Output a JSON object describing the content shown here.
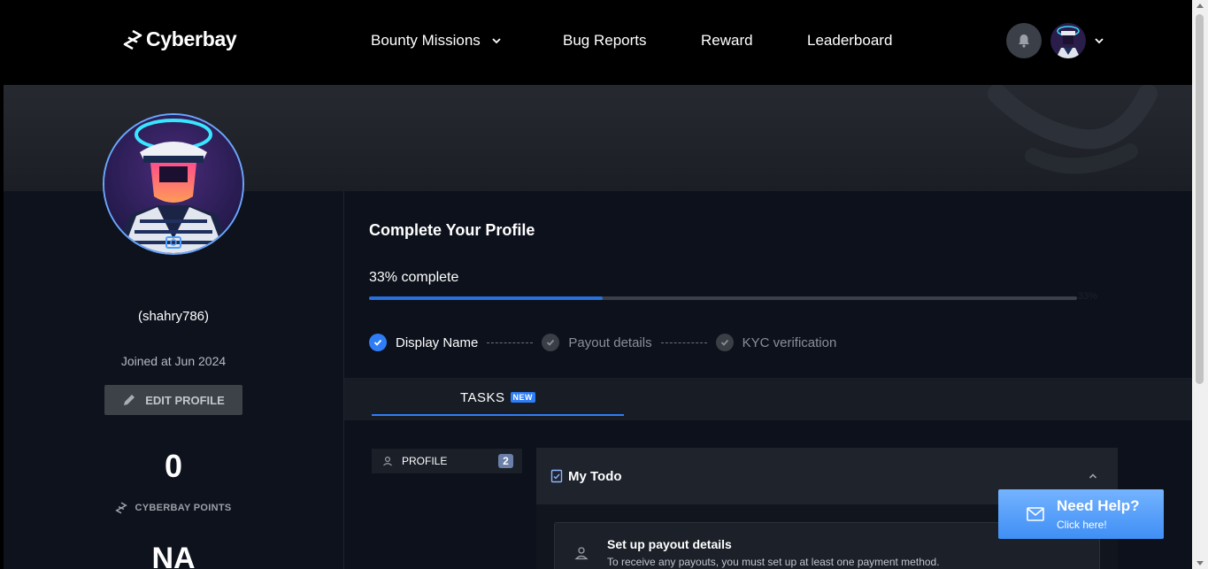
{
  "brand": {
    "name": "Cyberbay"
  },
  "nav": {
    "items": [
      {
        "label": "Bounty Missions",
        "has_dropdown": true
      },
      {
        "label": "Bug Reports"
      },
      {
        "label": "Reward"
      },
      {
        "label": "Leaderboard"
      }
    ]
  },
  "profile": {
    "username": "(shahry786)",
    "joined": "Joined at Jun 2024",
    "edit_label": "EDIT PROFILE",
    "points_value": "0",
    "points_label": "CYBERBAY POINTS",
    "rank_value": "NA"
  },
  "completion": {
    "title": "Complete Your Profile",
    "progress_text": "33% complete",
    "progress_percent": 33,
    "progress_end_label": "33%",
    "steps": [
      {
        "label": "Display Name",
        "done": true
      },
      {
        "label": "Payout details",
        "done": false
      },
      {
        "label": "KYC verification",
        "done": false
      }
    ]
  },
  "tasks": {
    "tab_label": "TASKS",
    "new_badge": "NEW",
    "category_label": "PROFILE",
    "category_count": "2",
    "todo_title": "My Todo",
    "items": [
      {
        "title": "Set up payout details",
        "description": "To receive any payouts, you must set up at least one payment method."
      }
    ]
  },
  "help": {
    "title": "Need Help?",
    "subtitle": "Click here!"
  },
  "colors": {
    "accent": "#2f7df6",
    "background": "#0c111b",
    "header": "#000000"
  }
}
